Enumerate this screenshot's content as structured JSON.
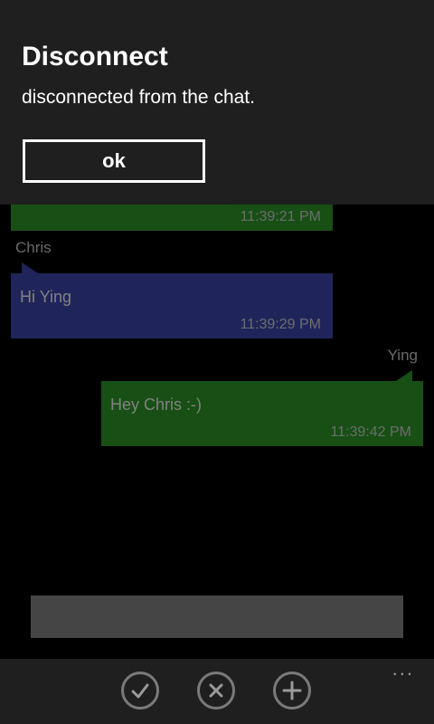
{
  "dialog": {
    "title": "Disconnect",
    "message": "disconnected from the chat.",
    "ok_label": "ok"
  },
  "chat": {
    "messages": [
      {
        "sender": "",
        "text": "",
        "time": "11:39:21 PM",
        "color": "#2f9e2a",
        "side": "left"
      },
      {
        "sender": "Chris",
        "text": "Hi Ying",
        "time": "11:39:29 PM",
        "color": "#3f4ab5",
        "side": "left"
      },
      {
        "sender": "Ying",
        "text": "Hey Chris :-)",
        "time": "11:39:42 PM",
        "color": "#2f9e2a",
        "side": "right"
      }
    ]
  },
  "appbar": {
    "buttons": [
      {
        "icon": "check-icon"
      },
      {
        "icon": "close-icon"
      },
      {
        "icon": "add-icon"
      }
    ],
    "more": "..."
  },
  "colors": {
    "dialog_bg": "#1f1f1f",
    "accent_green": "#2f9e2a",
    "accent_blue": "#3f4ab5"
  }
}
